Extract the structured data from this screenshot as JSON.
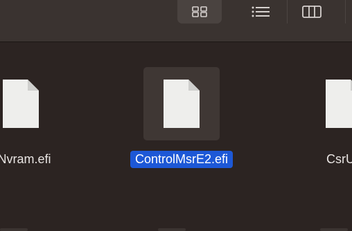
{
  "toolbar": {
    "view_buttons": [
      {
        "name": "icon-view",
        "icon": "grid-icon",
        "active": true
      },
      {
        "name": "list-view",
        "icon": "list-icon",
        "active": false
      },
      {
        "name": "column-view",
        "icon": "columns-icon",
        "active": false
      }
    ]
  },
  "files": [
    {
      "name": "nNvram.efi",
      "selected": false
    },
    {
      "name": "ControlMsrE2.efi",
      "selected": true
    },
    {
      "name": "CsrUti",
      "selected": false
    }
  ],
  "colors": {
    "selection": "#1d58d6",
    "background": "#2c2422",
    "toolbar": "#3a3330"
  }
}
